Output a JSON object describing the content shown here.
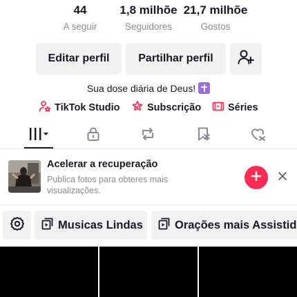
{
  "stats": [
    {
      "value": "44",
      "label": "A seguir"
    },
    {
      "value": "1,8 milhõe",
      "label": "Seguidores"
    },
    {
      "value": "21,7 milhõe",
      "label": "Gostos"
    }
  ],
  "actions": {
    "edit_label": "Editar perfil",
    "share_label": "Partilhar perfil",
    "add_friend_icon": "add-user-icon"
  },
  "bio": {
    "text": "Sua dose diária de Deus!",
    "badge_icon": "latin-cross-emoji"
  },
  "links": [
    {
      "icon": "person-star-icon",
      "label": "TikTok Studio"
    },
    {
      "icon": "subscription-icon",
      "label": "Subscrição"
    },
    {
      "icon": "series-icon",
      "label": "Séries"
    }
  ],
  "tabs": [
    {
      "icon": "videos-grid-icon",
      "active": true
    },
    {
      "icon": "lock-icon",
      "active": false
    },
    {
      "icon": "repost-icon",
      "active": false
    },
    {
      "icon": "favorites-bookmark-icon",
      "active": false
    },
    {
      "icon": "liked-heart-icon",
      "active": false
    }
  ],
  "promo": {
    "title": "Acelerar a recuperação",
    "description": "Publica fotos para obteres mais visualizações."
  },
  "playlists": [
    {
      "icon": "playlist-icon",
      "label": "Musicas Lindas"
    },
    {
      "icon": "playlist-icon",
      "label": "Orações mais Assistidas"
    }
  ],
  "colors": {
    "accent": "#fe2c55",
    "text": "#161823",
    "muted": "#8a8b91",
    "chip_bg": "#f1f1f2",
    "badge": "#9c6bde"
  }
}
